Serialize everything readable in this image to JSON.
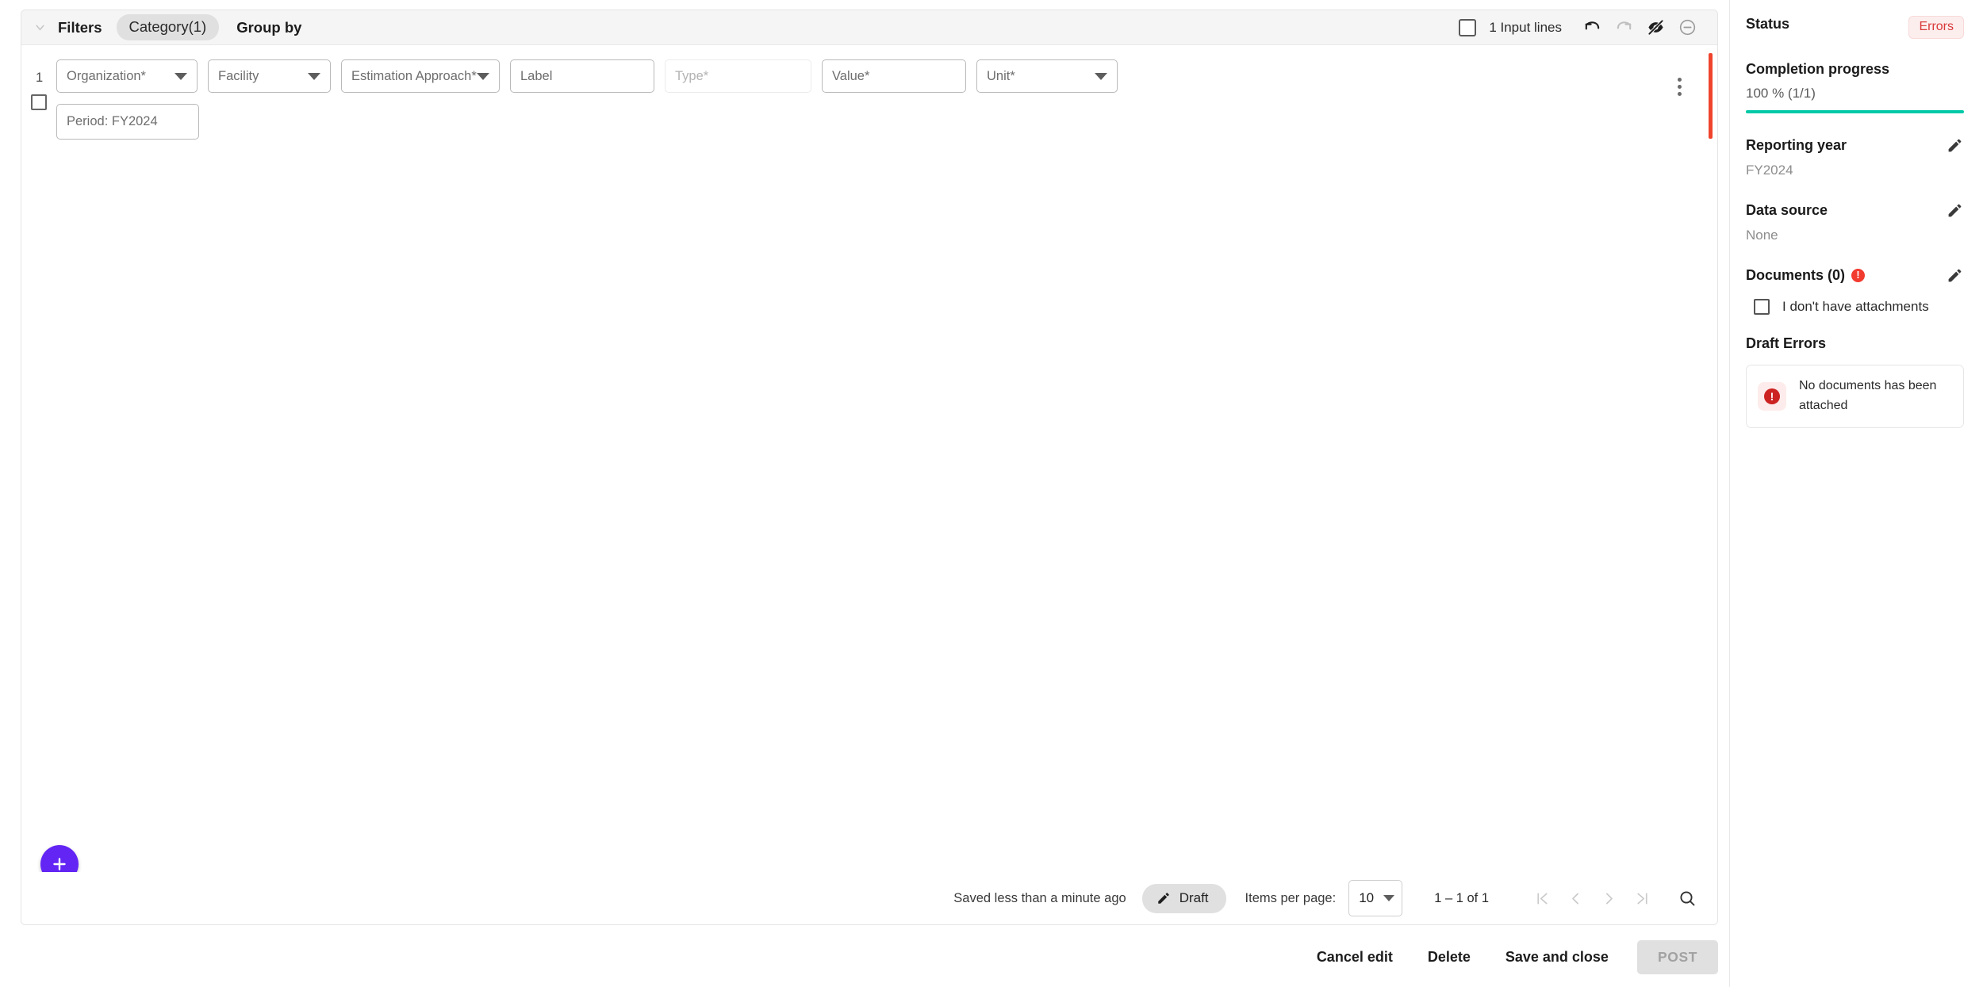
{
  "filter_bar": {
    "collapse_icon": "chevron-down-icon",
    "filters_label": "Filters",
    "category_chip": "Category(1)",
    "group_by_label": "Group by",
    "input_lines_label": "1 Input lines",
    "icons": [
      "undo-icon",
      "redo-icon",
      "eye-off-icon",
      "minus-circle-icon"
    ]
  },
  "row": {
    "number": "1",
    "fields": [
      {
        "label": "Organization*",
        "type": "select"
      },
      {
        "label": "Facility",
        "type": "select"
      },
      {
        "label": "Estimation Approach*",
        "type": "select"
      },
      {
        "label": "Label",
        "type": "text"
      },
      {
        "label": "Type*",
        "type": "text-disabled"
      },
      {
        "label": "Value*",
        "type": "text"
      },
      {
        "label": "Unit*",
        "type": "select"
      },
      {
        "label": "Period: FY2024",
        "type": "text"
      }
    ]
  },
  "fab": {
    "label": "add-button",
    "color": "#6325f4"
  },
  "footer": {
    "saved_text": "Saved less than a minute ago",
    "draft_label": "Draft",
    "items_per_page_label": "Items per page:",
    "items_per_page_value": "10",
    "range_label": "1 – 1 of 1",
    "search_icon": "search-icon"
  },
  "actions": {
    "cancel": "Cancel edit",
    "delete": "Delete",
    "save_close": "Save and close",
    "post": "POST"
  },
  "sidebar": {
    "status_title": "Status",
    "status_badge": "Errors",
    "completion_title": "Completion progress",
    "completion_value": "100 % (1/1)",
    "completion_percent": 100,
    "completion_color": "#00c9a7",
    "reporting_year_title": "Reporting year",
    "reporting_year_value": "FY2024",
    "data_source_title": "Data source",
    "data_source_value": "None",
    "documents_title": "Documents (0)",
    "attachments_checkbox_label": "I don't have attachments",
    "draft_errors_title": "Draft Errors",
    "draft_error_message": "No documents has been attached"
  }
}
